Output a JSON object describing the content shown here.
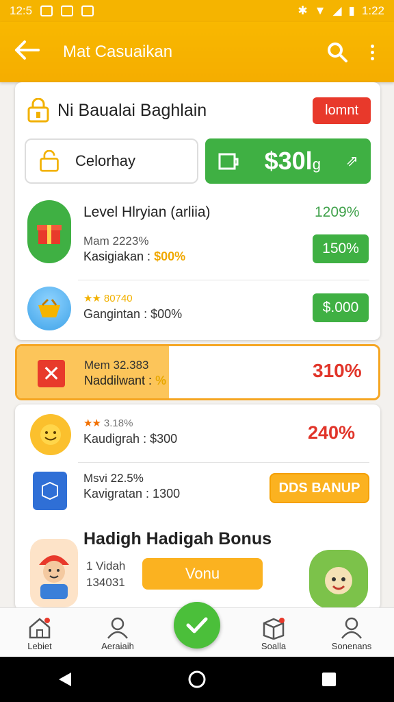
{
  "status_bar": {
    "time_left": "12:5",
    "time_right": "1:22"
  },
  "app_bar": {
    "title": "Mat Casuaikan"
  },
  "card1": {
    "title": "Ni Baualai Baghlain",
    "red_button": "lomnt",
    "pill_left_label": "Celorhay",
    "pill_right_amount": "$30l",
    "pill_right_suffix": "g",
    "row1": {
      "title": "Level Hlryian (arliia)",
      "percent": "1209%",
      "line1": "Mam 2223%",
      "line2_label": "Kasigiakan :",
      "line2_value": "$00%",
      "badge": "150%"
    },
    "row2": {
      "stars": "★★",
      "stars_text": "80740",
      "line2": "Gangintan : $00%",
      "badge": "$.000"
    }
  },
  "highlight": {
    "line1": "Mem 32.383",
    "line2_label": "Naddilwant :",
    "line2_value": "%",
    "percent": "310%",
    "fill_fraction": 0.42
  },
  "card3": {
    "row1": {
      "stars": "★★",
      "stars_text": "3.18%",
      "line2": "Kaudigrah : $300",
      "percent": "240%"
    },
    "row2": {
      "line1": "Msvi 22.5%",
      "line2": "Kavigratan : 1300",
      "button": "DDS BANUP"
    },
    "bonus": {
      "title": "Hadigh Hadigah Bonus",
      "line1": "1 Vidah",
      "line2": "134031",
      "button": "Vonu"
    }
  },
  "bottom_nav": {
    "items": [
      "Lebiet",
      "Aeraiaih",
      "Soalla",
      "Sonenans"
    ]
  },
  "colors": {
    "accent": "#f5b400",
    "green": "#3fb043",
    "red": "#e1352a"
  }
}
